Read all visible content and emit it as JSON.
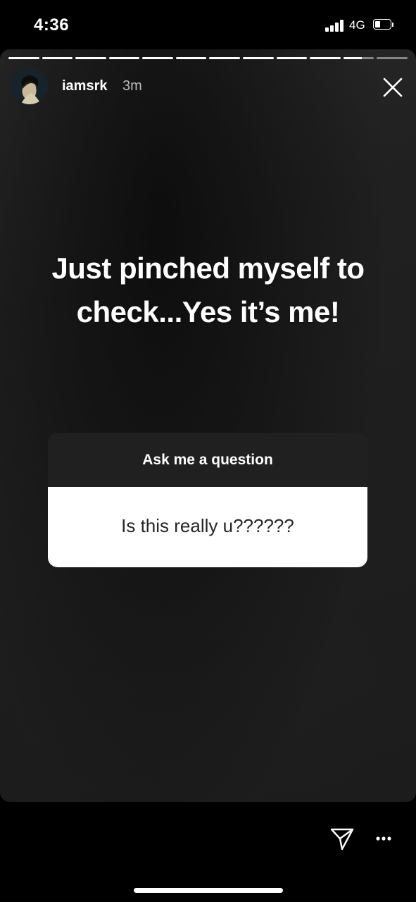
{
  "status_bar": {
    "time": "4:36",
    "network": "4G",
    "signal_icon": "signal-bars-icon",
    "battery_icon": "battery-icon",
    "battery_level": 0.35
  },
  "story": {
    "progress": {
      "segments": 12,
      "completed": 10,
      "current_fraction": 0.6
    },
    "user": {
      "username": "iamsrk",
      "time_ago": "3m",
      "avatar_icon": "profile-avatar"
    },
    "caption_lines": [
      "Just pinched myself to",
      "check...Yes it’s me!"
    ],
    "question_sticker": {
      "header": "Ask me a question",
      "question": "Is this really u??????"
    },
    "close_icon": "close-icon",
    "send_icon": "send-icon",
    "more_icon": "more-options-icon"
  },
  "colors": {
    "background": "#000000",
    "sticker_header": "#202020",
    "sticker_body": "#ffffff",
    "sticker_text": "#262626"
  }
}
